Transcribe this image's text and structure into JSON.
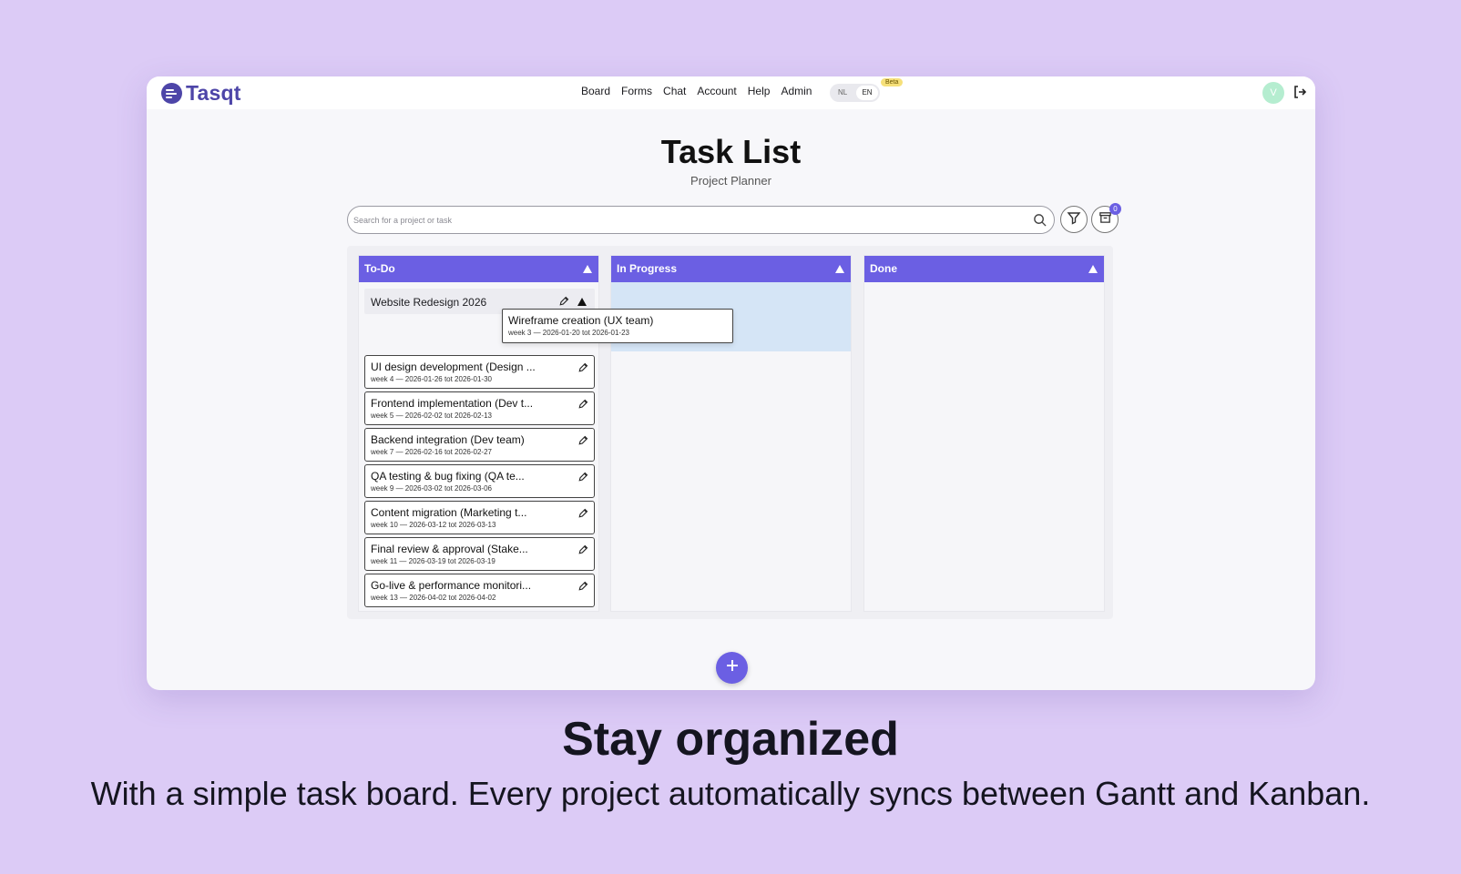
{
  "app": {
    "name": "Tasqt",
    "nav": [
      "Board",
      "Forms",
      "Chat",
      "Account",
      "Help",
      "Admin"
    ],
    "lang": {
      "nl": "NL",
      "en": "EN",
      "beta": "Beta"
    },
    "avatar_initial": "V",
    "accent": "#6b5fe3",
    "brand": "#4d45a8"
  },
  "page": {
    "title": "Task List",
    "subtitle": "Project Planner",
    "search_placeholder": "Search for a project or task",
    "archive_count": "0"
  },
  "board": {
    "columns": [
      {
        "label": "To-Do"
      },
      {
        "label": "In Progress"
      },
      {
        "label": "Done"
      }
    ],
    "project": "Website Redesign 2026",
    "dragging": {
      "title": "Wireframe creation (UX team)",
      "dates": "week 3 — 2026-01-20 tot 2026-01-23"
    },
    "tasks": [
      {
        "title": "UI design development (Design ...",
        "dates": "week 4 — 2026-01-26 tot 2026-01-30"
      },
      {
        "title": "Frontend implementation (Dev t...",
        "dates": "week 5 — 2026-02-02 tot 2026-02-13"
      },
      {
        "title": "Backend integration (Dev team)",
        "dates": "week 7 — 2026-02-16 tot 2026-02-27"
      },
      {
        "title": "QA testing & bug fixing (QA te...",
        "dates": "week 9 — 2026-03-02 tot 2026-03-06"
      },
      {
        "title": "Content migration (Marketing t...",
        "dates": "week 10 — 2026-03-12 tot 2026-03-13"
      },
      {
        "title": "Final review & approval (Stake...",
        "dates": "week 11 — 2026-03-19 tot 2026-03-19"
      },
      {
        "title": "Go-live & performance monitori...",
        "dates": "week 13 — 2026-04-02 tot 2026-04-02"
      }
    ]
  },
  "marketing": {
    "headline": "Stay organized",
    "tagline": "With a simple task board. Every project automatically syncs between Gantt and Kanban."
  }
}
